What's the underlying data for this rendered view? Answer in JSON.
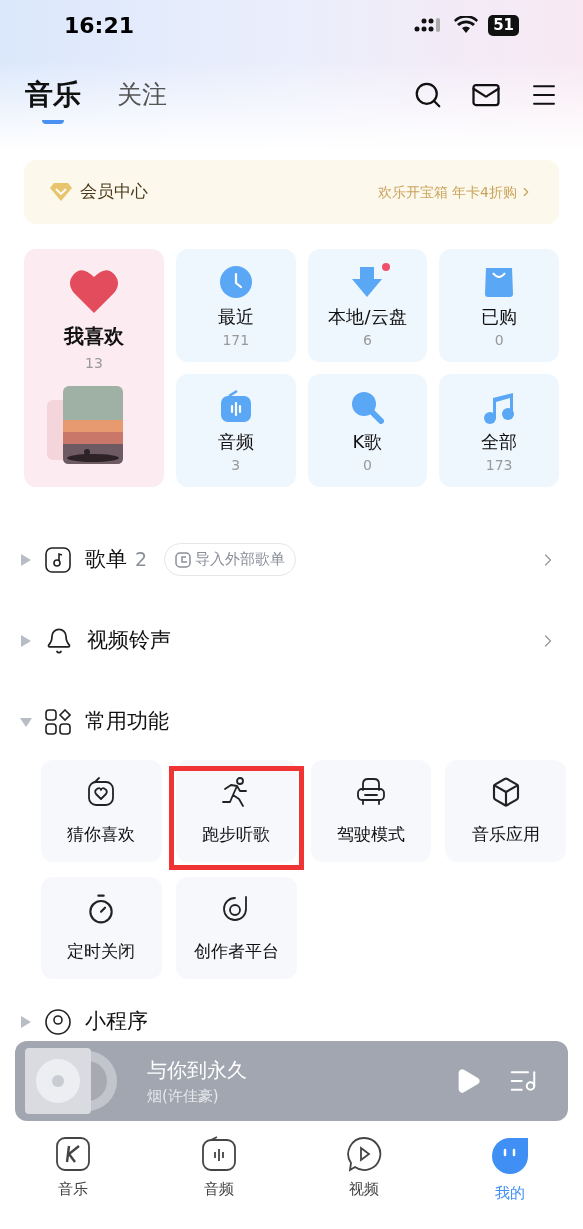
{
  "status_bar": {
    "time": "16:21",
    "battery": "51"
  },
  "tabs": [
    {
      "label": "音乐",
      "selected": true
    },
    {
      "label": "关注",
      "selected": false
    }
  ],
  "vip": {
    "title": "会员中心",
    "promo": "欢乐开宝箱 年卡4折购"
  },
  "favorite": {
    "label": "我喜欢",
    "count": "13"
  },
  "shortcuts": [
    {
      "kind": "recent",
      "label": "最近",
      "count": "171",
      "badge": false
    },
    {
      "kind": "local",
      "label": "本地/云盘",
      "count": "6",
      "badge": true
    },
    {
      "kind": "bought",
      "label": "已购",
      "count": "0",
      "badge": false
    },
    {
      "kind": "audio",
      "label": "音频",
      "count": "3",
      "badge": false
    },
    {
      "kind": "karaoke",
      "label": "K歌",
      "count": "0",
      "badge": false
    },
    {
      "kind": "all",
      "label": "全部",
      "count": "173",
      "badge": false
    }
  ],
  "sections": [
    {
      "kind": "playlist",
      "label": "歌单",
      "count": "2",
      "import_label": "导入外部歌单",
      "expanded": false
    },
    {
      "kind": "ringtone",
      "label": "视频铃声",
      "expanded": false
    },
    {
      "kind": "features",
      "label": "常用功能",
      "expanded": true
    }
  ],
  "features": [
    {
      "kind": "guess",
      "label": "猜你喜欢",
      "highlighted": false
    },
    {
      "kind": "running",
      "label": "跑步听歌",
      "highlighted": true
    },
    {
      "kind": "driving",
      "label": "驾驶模式",
      "highlighted": false
    },
    {
      "kind": "apps",
      "label": "音乐应用",
      "highlighted": false
    },
    {
      "kind": "timer",
      "label": "定时关闭",
      "highlighted": false
    },
    {
      "kind": "creator",
      "label": "创作者平台",
      "highlighted": false
    }
  ],
  "partial_section": {
    "label": "小程序",
    "expanded": false
  },
  "player": {
    "title": "与你到永久",
    "artist": "烟(许佳豪)"
  },
  "nav": [
    {
      "kind": "music",
      "label": "音乐",
      "selected": false
    },
    {
      "kind": "audio",
      "label": "音频",
      "selected": false
    },
    {
      "kind": "video",
      "label": "视频",
      "selected": false
    },
    {
      "kind": "mine",
      "label": "我的",
      "selected": true
    }
  ]
}
